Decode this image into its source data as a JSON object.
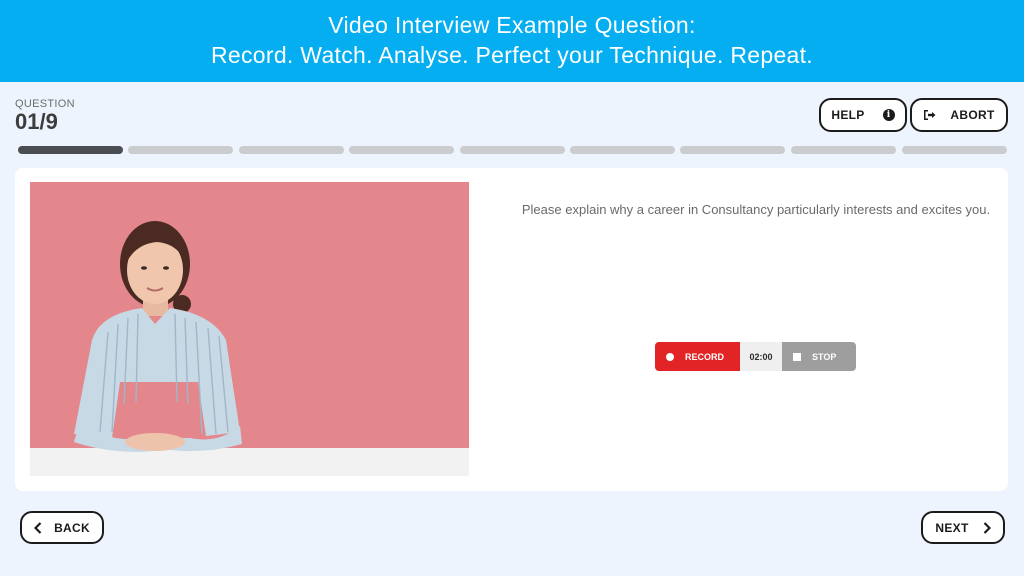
{
  "banner": {
    "line1": "Video Interview Example Question:",
    "line2": "Record. Watch. Analyse. Perfect your Technique. Repeat."
  },
  "question_header": {
    "label": "QUESTION",
    "counter": "01/9"
  },
  "toolbar": {
    "help_label": "HELP",
    "help_icon": "info-icon",
    "abort_label": "ABORT",
    "abort_icon": "sign-out-icon"
  },
  "progress": {
    "total": 9,
    "current": 1
  },
  "question": {
    "text": "Please explain why a career in Consultancy particularly interests and excites you."
  },
  "recorder": {
    "record_label": "RECORD",
    "timer": "02:00",
    "stop_label": "STOP"
  },
  "nav": {
    "back_label": "BACK",
    "next_label": "NEXT"
  },
  "colors": {
    "banner": "#04aef0",
    "record": "#e22426",
    "stop": "#9e9e9e",
    "photo_background": "#e3878d"
  }
}
